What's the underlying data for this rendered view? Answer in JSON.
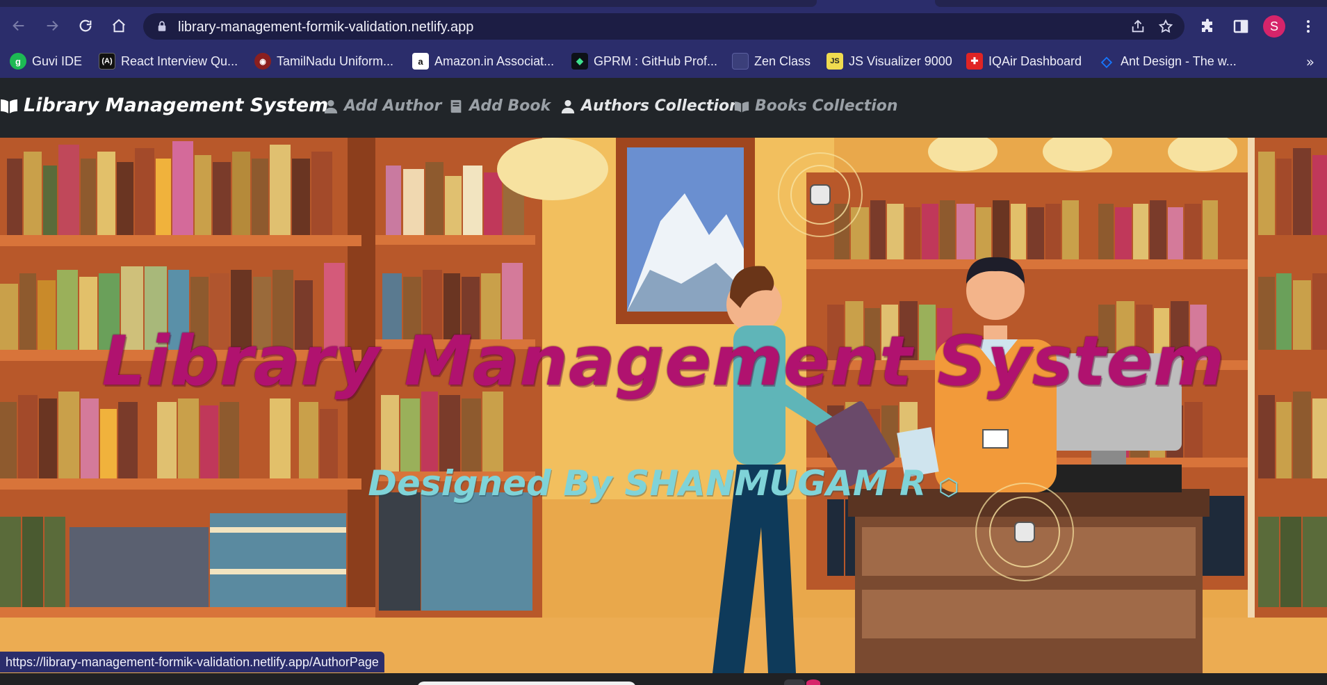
{
  "browser": {
    "url": "library-management-formik-validation.netlify.app",
    "profile_initial": "S",
    "status_url": "https://library-management-formik-validation.netlify.app/AuthorPage",
    "nav_icons": [
      "back-arrow-icon",
      "forward-arrow-icon",
      "reload-icon",
      "home-icon"
    ],
    "toolbar_icons": [
      "share-icon",
      "star-icon",
      "extensions-icon",
      "side-panel-icon",
      "kebab-menu-icon"
    ],
    "accent_color": "#2b2d6b"
  },
  "bookmarks": [
    {
      "label": "Guvi IDE",
      "icon": "guvi-icon",
      "color": "#1db954"
    },
    {
      "label": "React Interview Qu...",
      "icon": "react-icon",
      "color": "#111111"
    },
    {
      "label": "TamilNadu Uniform...",
      "icon": "tn-emblem-icon",
      "color": "#8a1f1f"
    },
    {
      "label": "Amazon.in Associat...",
      "icon": "amazon-icon",
      "color": "#ffffff"
    },
    {
      "label": "GPRM : GitHub Prof...",
      "icon": "gprm-icon",
      "color": "#0d1117"
    },
    {
      "label": "Zen Class",
      "icon": "zen-icon",
      "color": "#3b3f7a"
    },
    {
      "label": "JS Visualizer 9000",
      "icon": "js-icon",
      "color": "#f0db4f"
    },
    {
      "label": "IQAir Dashboard",
      "icon": "iqair-icon",
      "color": "#e02424"
    },
    {
      "label": "Ant Design - The w...",
      "icon": "antd-icon",
      "color": "#1677ff"
    }
  ],
  "bookmarks_more": "»",
  "navbar": {
    "brand": "Library Management System",
    "links": [
      {
        "label": "Add Author",
        "icon": "user-icon",
        "active": false
      },
      {
        "label": "Add Book",
        "icon": "book-icon",
        "active": false
      },
      {
        "label": "Authors Collection",
        "icon": "user-icon",
        "active": true
      },
      {
        "label": "Books Collection",
        "icon": "open-book-icon",
        "active": false
      }
    ]
  },
  "hero": {
    "title": "Library Management System",
    "subtitle": "Designed By SHANMUGAM R",
    "title_color": "#b0126f",
    "subtitle_color": "#7fd3d8"
  }
}
